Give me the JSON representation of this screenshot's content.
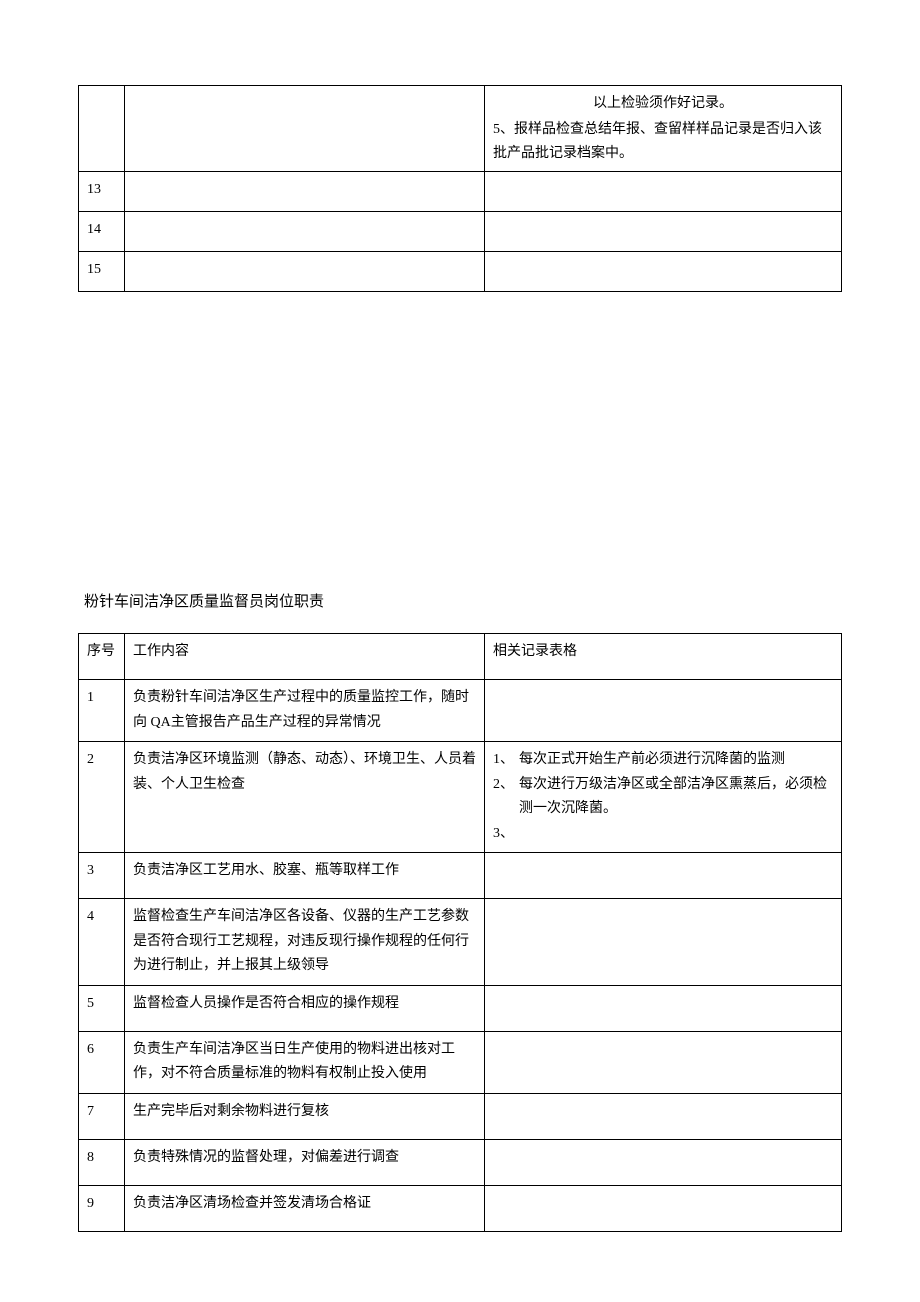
{
  "table1": {
    "row12": {
      "num": "",
      "work": "",
      "record_line1": "以上检验须作好记录。",
      "record_line2": "5、报样品检查总结年报、查留样样品记录是否归入该批产品批记录档案中。"
    },
    "row13": {
      "num": "13",
      "work": "",
      "record": ""
    },
    "row14": {
      "num": "14",
      "work": "",
      "record": ""
    },
    "row15": {
      "num": "15",
      "work": "",
      "record": ""
    }
  },
  "section_title": "粉针车间洁净区质量监督员岗位职责",
  "table2": {
    "header": {
      "num": "序号",
      "work": "工作内容",
      "record": "相关记录表格"
    },
    "rows": [
      {
        "num": "1",
        "work": "负责粉针车间洁净区生产过程中的质量监控工作，随时向 QA主管报告产品生产过程的异常情况",
        "record": ""
      },
      {
        "num": "2",
        "work": "负责洁净区环境监测（静态、动态）、环境卫生、人员着装、个人卫生检查",
        "record_items": [
          {
            "n": "1、",
            "t": "每次正式开始生产前必须进行沉降菌的监测"
          },
          {
            "n": "2、",
            "t": "每次进行万级洁净区或全部洁净区熏蒸后，必须检测一次沉降菌。"
          },
          {
            "n": "3、",
            "t": ""
          }
        ]
      },
      {
        "num": "3",
        "work": "负责洁净区工艺用水、胶塞、瓶等取样工作",
        "record": ""
      },
      {
        "num": "4",
        "work": "监督检查生产车间洁净区各设备、仪器的生产工艺参数是否符合现行工艺规程，对违反现行操作规程的任何行为进行制止，并上报其上级领导",
        "record": ""
      },
      {
        "num": "5",
        "work": "监督检查人员操作是否符合相应的操作规程",
        "record": ""
      },
      {
        "num": "6",
        "work": "负责生产车间洁净区当日生产使用的物料进出核对工作，对不符合质量标准的物料有权制止投入使用",
        "record": ""
      },
      {
        "num": "7",
        "work": "生产完毕后对剩余物料进行复核",
        "record": ""
      },
      {
        "num": "8",
        "work": "负责特殊情况的监督处理，对偏差进行调查",
        "record": ""
      },
      {
        "num": "9",
        "work": "负责洁净区清场检查并签发清场合格证",
        "record": ""
      }
    ]
  }
}
